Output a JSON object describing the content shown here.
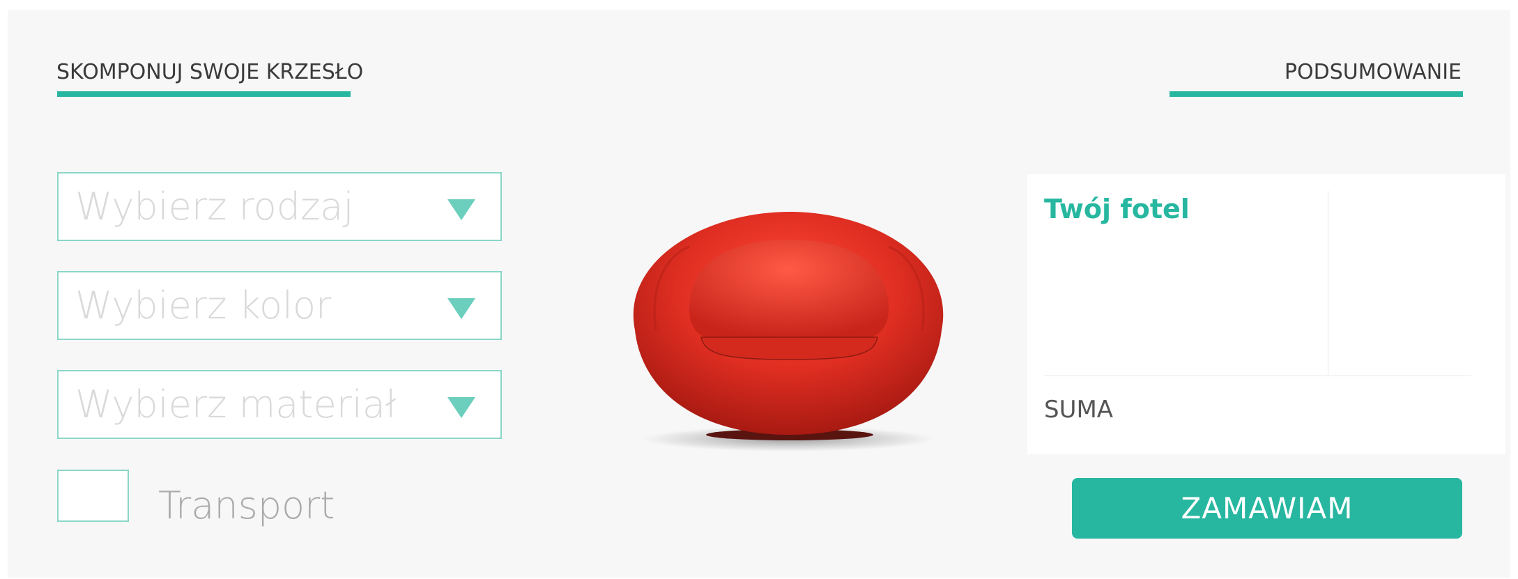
{
  "header": {
    "left_title": "SKOMPONUJ SWOJE KRZESŁO",
    "right_title": "PODSUMOWANIE"
  },
  "form": {
    "selects": [
      {
        "placeholder": "Wybierz rodzaj"
      },
      {
        "placeholder": "Wybierz kolor"
      },
      {
        "placeholder": "Wybierz materiał"
      }
    ],
    "transport_label": "Transport",
    "transport_checked": false
  },
  "summary": {
    "heading": "Twój fotel",
    "total_label": "SUMA"
  },
  "order_button_label": "ZAMAWIAM",
  "colors": {
    "accent": "#27b7a0",
    "chair": "#e02e22",
    "background": "#f7f7f7"
  }
}
